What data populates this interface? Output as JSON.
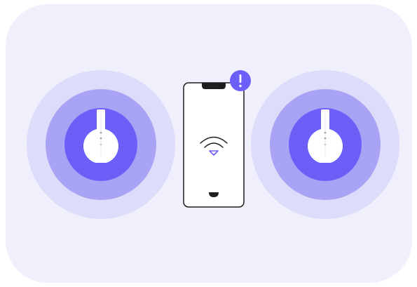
{
  "colors": {
    "panel_bg": "#F0F0FD",
    "ring_outer": "#DDDCFA",
    "ring_middle": "#A8A3F5",
    "ring_inner": "#6C5FF7",
    "device_body": "#FFFFFF",
    "outline": "#1E1E1E",
    "accent": "#6C5FF7"
  },
  "illustration": {
    "left_device": {
      "icon": "wifi-extender-icon",
      "signal": "strong"
    },
    "right_device": {
      "icon": "wifi-extender-icon",
      "signal": "strong"
    },
    "phone": {
      "icon": "smartphone-icon",
      "wifi_indicator": "wifi-icon"
    },
    "alert_badge": {
      "icon": "exclamation-icon",
      "symbol": "!"
    }
  }
}
